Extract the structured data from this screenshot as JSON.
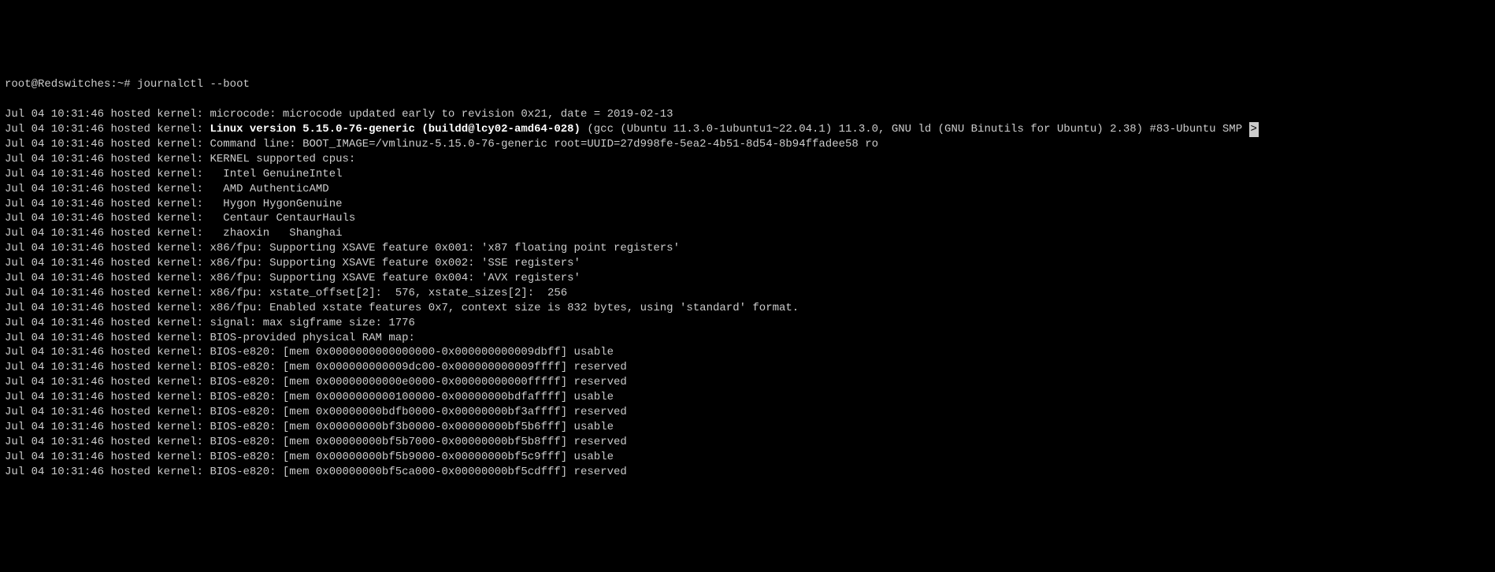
{
  "prompt": {
    "user_host": "root@Redswitches",
    "path": "~",
    "command": "journalctl --boot"
  },
  "lines": [
    {
      "ts": "Jul 04 10:31:46",
      "host": "hosted",
      "src": "kernel:",
      "msg": "microcode: microcode updated early to revision 0x21, date = 2019-02-13"
    },
    {
      "ts": "Jul 04 10:31:46",
      "host": "hosted",
      "src": "kernel:",
      "highlight_prefix": "Linux version 5.15.0-76-generic (buildd@lcy02-amd64-028)",
      "msg_suffix": " (gcc (Ubuntu 11.3.0-1ubuntu1~22.04.1) 11.3.0, GNU ld (GNU Binutils for Ubuntu) 2.38) #83-Ubuntu SMP ",
      "scroll_marker": ">"
    },
    {
      "ts": "Jul 04 10:31:46",
      "host": "hosted",
      "src": "kernel:",
      "msg": "Command line: BOOT_IMAGE=/vmlinuz-5.15.0-76-generic root=UUID=27d998fe-5ea2-4b51-8d54-8b94ffadee58 ro"
    },
    {
      "ts": "Jul 04 10:31:46",
      "host": "hosted",
      "src": "kernel:",
      "msg": "KERNEL supported cpus:"
    },
    {
      "ts": "Jul 04 10:31:46",
      "host": "hosted",
      "src": "kernel:",
      "msg": "  Intel GenuineIntel"
    },
    {
      "ts": "Jul 04 10:31:46",
      "host": "hosted",
      "src": "kernel:",
      "msg": "  AMD AuthenticAMD"
    },
    {
      "ts": "Jul 04 10:31:46",
      "host": "hosted",
      "src": "kernel:",
      "msg": "  Hygon HygonGenuine"
    },
    {
      "ts": "Jul 04 10:31:46",
      "host": "hosted",
      "src": "kernel:",
      "msg": "  Centaur CentaurHauls"
    },
    {
      "ts": "Jul 04 10:31:46",
      "host": "hosted",
      "src": "kernel:",
      "msg": "  zhaoxin   Shanghai"
    },
    {
      "ts": "Jul 04 10:31:46",
      "host": "hosted",
      "src": "kernel:",
      "msg": "x86/fpu: Supporting XSAVE feature 0x001: 'x87 floating point registers'"
    },
    {
      "ts": "Jul 04 10:31:46",
      "host": "hosted",
      "src": "kernel:",
      "msg": "x86/fpu: Supporting XSAVE feature 0x002: 'SSE registers'"
    },
    {
      "ts": "Jul 04 10:31:46",
      "host": "hosted",
      "src": "kernel:",
      "msg": "x86/fpu: Supporting XSAVE feature 0x004: 'AVX registers'"
    },
    {
      "ts": "Jul 04 10:31:46",
      "host": "hosted",
      "src": "kernel:",
      "msg": "x86/fpu: xstate_offset[2]:  576, xstate_sizes[2]:  256"
    },
    {
      "ts": "Jul 04 10:31:46",
      "host": "hosted",
      "src": "kernel:",
      "msg": "x86/fpu: Enabled xstate features 0x7, context size is 832 bytes, using 'standard' format."
    },
    {
      "ts": "Jul 04 10:31:46",
      "host": "hosted",
      "src": "kernel:",
      "msg": "signal: max sigframe size: 1776"
    },
    {
      "ts": "Jul 04 10:31:46",
      "host": "hosted",
      "src": "kernel:",
      "msg": "BIOS-provided physical RAM map:"
    },
    {
      "ts": "Jul 04 10:31:46",
      "host": "hosted",
      "src": "kernel:",
      "msg": "BIOS-e820: [mem 0x0000000000000000-0x000000000009dbff] usable"
    },
    {
      "ts": "Jul 04 10:31:46",
      "host": "hosted",
      "src": "kernel:",
      "msg": "BIOS-e820: [mem 0x000000000009dc00-0x000000000009ffff] reserved"
    },
    {
      "ts": "Jul 04 10:31:46",
      "host": "hosted",
      "src": "kernel:",
      "msg": "BIOS-e820: [mem 0x00000000000e0000-0x00000000000fffff] reserved"
    },
    {
      "ts": "Jul 04 10:31:46",
      "host": "hosted",
      "src": "kernel:",
      "msg": "BIOS-e820: [mem 0x0000000000100000-0x00000000bdfaffff] usable"
    },
    {
      "ts": "Jul 04 10:31:46",
      "host": "hosted",
      "src": "kernel:",
      "msg": "BIOS-e820: [mem 0x00000000bdfb0000-0x00000000bf3affff] reserved"
    },
    {
      "ts": "Jul 04 10:31:46",
      "host": "hosted",
      "src": "kernel:",
      "msg": "BIOS-e820: [mem 0x00000000bf3b0000-0x00000000bf5b6fff] usable"
    },
    {
      "ts": "Jul 04 10:31:46",
      "host": "hosted",
      "src": "kernel:",
      "msg": "BIOS-e820: [mem 0x00000000bf5b7000-0x00000000bf5b8fff] reserved"
    },
    {
      "ts": "Jul 04 10:31:46",
      "host": "hosted",
      "src": "kernel:",
      "msg": "BIOS-e820: [mem 0x00000000bf5b9000-0x00000000bf5c9fff] usable"
    },
    {
      "ts": "Jul 04 10:31:46",
      "host": "hosted",
      "src": "kernel:",
      "msg": "BIOS-e820: [mem 0x00000000bf5ca000-0x00000000bf5cdfff] reserved"
    }
  ]
}
